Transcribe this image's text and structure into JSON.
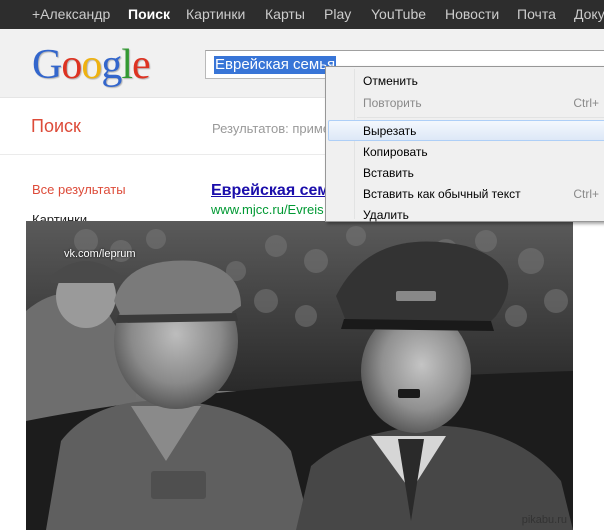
{
  "topbar": {
    "items": [
      {
        "label": "+Александр",
        "active": false
      },
      {
        "label": "Поиск",
        "active": true
      },
      {
        "label": "Картинки",
        "active": false
      },
      {
        "label": "Карты",
        "active": false
      },
      {
        "label": "Play",
        "active": false
      },
      {
        "label": "YouTube",
        "active": false
      },
      {
        "label": "Новости",
        "active": false
      },
      {
        "label": "Почта",
        "active": false
      },
      {
        "label": "Доку",
        "active": false
      }
    ]
  },
  "logo": {
    "letters": [
      "G",
      "o",
      "o",
      "g",
      "l",
      "e"
    ],
    "colors": [
      "#3366cc",
      "#dd3322",
      "#eeb211",
      "#3366cc",
      "#339933",
      "#dd3322"
    ]
  },
  "search": {
    "value": "Еврейская семья"
  },
  "subheader": {
    "title": "Поиск",
    "stats": "Результатов: приме"
  },
  "nav": {
    "items": [
      "Все результаты",
      "Картинки"
    ]
  },
  "result": {
    "title": "Еврейская сем",
    "url": "www.mjcc.ru/Evreis"
  },
  "context_menu": {
    "items": [
      {
        "label": "Отменить",
        "shortcut": "",
        "disabled": false,
        "hover": false
      },
      {
        "label": "Повторить",
        "shortcut": "Ctrl+",
        "disabled": true,
        "hover": false
      },
      {
        "label": "Вырезать",
        "shortcut": "",
        "disabled": false,
        "hover": true
      },
      {
        "label": "Копировать",
        "shortcut": "",
        "disabled": false,
        "hover": false
      },
      {
        "label": "Вставить",
        "shortcut": "",
        "disabled": false,
        "hover": false
      },
      {
        "label": "Вставить как обычный текст",
        "shortcut": "Ctrl+",
        "disabled": false,
        "hover": false
      },
      {
        "label": "Удалить",
        "shortcut": "",
        "disabled": false,
        "hover": false
      }
    ]
  },
  "photo": {
    "watermark": "vk.com/leprum",
    "source": "pikabu.ru"
  }
}
